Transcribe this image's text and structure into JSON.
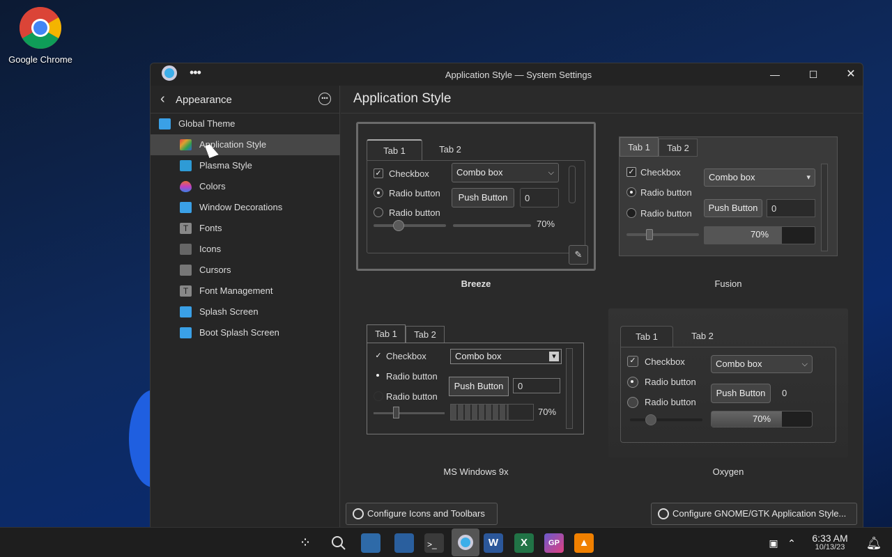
{
  "desktop": {
    "icon_label": "Google Chrome"
  },
  "window": {
    "title": "Application Style — System Settings",
    "menu_icon": "overflow-dots-icon"
  },
  "sidebar": {
    "back_label": "Appearance",
    "items": [
      {
        "label": "Global Theme",
        "icon": "monitor-icon",
        "color": "#3aa0e6"
      },
      {
        "label": "Application Style",
        "icon": "app-style-icon",
        "color": "#e0a030"
      },
      {
        "label": "Plasma Style",
        "icon": "plasma-icon",
        "color": "#2e9bd6"
      },
      {
        "label": "Colors",
        "icon": "drop-icon",
        "color": "#e86a3a"
      },
      {
        "label": "Window Decorations",
        "icon": "window-icon",
        "color": "#3aa0e6"
      },
      {
        "label": "Fonts",
        "icon": "font-icon",
        "color": "#888888"
      },
      {
        "label": "Icons",
        "icon": "icons-icon",
        "color": "#666666"
      },
      {
        "label": "Cursors",
        "icon": "cursor-icon",
        "color": "#777777"
      },
      {
        "label": "Font Management",
        "icon": "font-manage-icon",
        "color": "#888888"
      },
      {
        "label": "Splash Screen",
        "icon": "splash-icon",
        "color": "#3aa0e6"
      },
      {
        "label": "Boot Splash Screen",
        "icon": "boot-splash-icon",
        "color": "#3aa0e6"
      }
    ]
  },
  "main": {
    "title": "Application Style",
    "styles": [
      {
        "name": "Breeze",
        "selected": true
      },
      {
        "name": "Fusion",
        "selected": false
      },
      {
        "name": "MS Windows 9x",
        "selected": false
      },
      {
        "name": "Oxygen",
        "selected": false
      }
    ],
    "preview": {
      "tab1": "Tab 1",
      "tab2": "Tab 2",
      "checkbox": "Checkbox",
      "radio": "Radio button",
      "combo": "Combo box",
      "push": "Push Button",
      "spin": "0",
      "progress": "70%",
      "progress_value": 0.7
    },
    "buttons": {
      "icons_toolbars": "Configure Icons and Toolbars",
      "gtk": "Configure GNOME/GTK Application Style..."
    }
  },
  "taskbar": {
    "time": "6:33 AM",
    "date": "10/13/23"
  },
  "colors": {
    "accent": "#3daee9",
    "window_bg": "#2a2a2a"
  }
}
